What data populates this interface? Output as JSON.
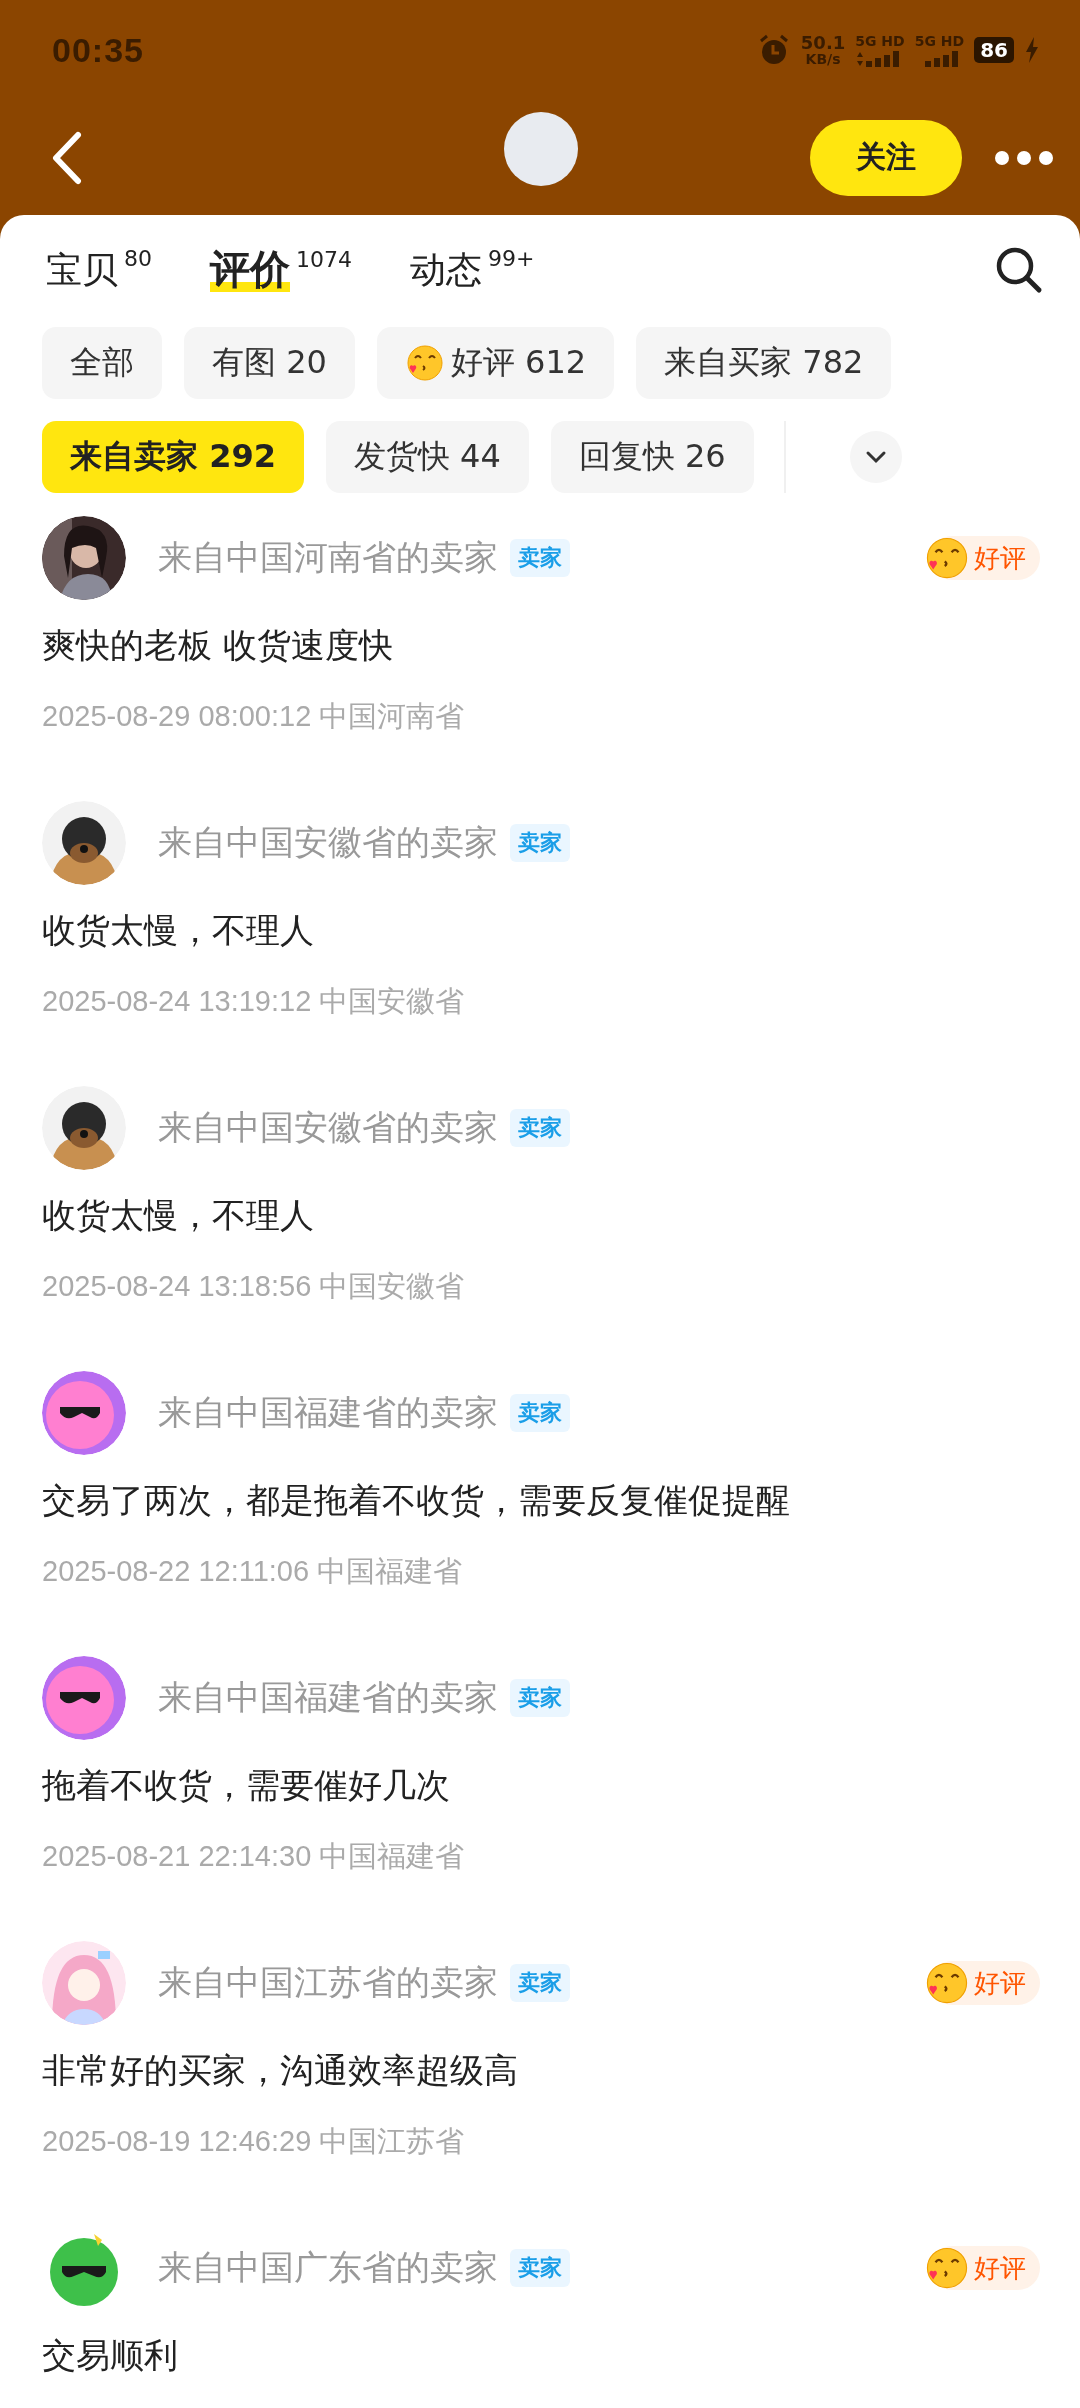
{
  "status_bar": {
    "time": "00:35",
    "speed": "50.1",
    "speed_unit": "KB/s",
    "network_1": "5G HD",
    "network_2": "5G HD",
    "battery": "86",
    "charging": true
  },
  "nav": {
    "follow_button": "关注"
  },
  "tabs": [
    {
      "label": "宝贝",
      "count": "80",
      "selected": false
    },
    {
      "label": "评价",
      "count": "1074",
      "selected": true
    },
    {
      "label": "动态",
      "count": "99+",
      "selected": false
    }
  ],
  "filter_rows": [
    [
      {
        "label": "全部",
        "selected": false
      },
      {
        "label": "有图 20",
        "selected": false
      },
      {
        "label": "好评 612",
        "selected": false,
        "kind": "emoji"
      },
      {
        "label": "来自买家 782",
        "selected": false
      }
    ],
    [
      {
        "label": "来自卖家 292",
        "selected": true
      },
      {
        "label": "发货快 44",
        "selected": false
      },
      {
        "label": "回复快 26",
        "selected": false
      }
    ]
  ],
  "reviews": [
    {
      "author": "来自中国河南省的卖家",
      "role": "卖家",
      "rating": "好评",
      "comment": "爽快的老板 收货速度快",
      "date": "2025-08-29 08:00:12 中国河南省"
    },
    {
      "author": "来自中国安徽省的卖家",
      "role": "卖家",
      "comment": "收货太慢，不理人",
      "date": "2025-08-24 13:19:12 中国安徽省"
    },
    {
      "author": "来自中国安徽省的卖家",
      "role": "卖家",
      "comment": "收货太慢，不理人",
      "date": "2025-08-24 13:18:56 中国安徽省"
    },
    {
      "author": "来自中国福建省的卖家",
      "role": "卖家",
      "comment": "交易了两次，都是拖着不收货，需要反复催促提醒",
      "date": "2025-08-22 12:11:06 中国福建省"
    },
    {
      "author": "来自中国福建省的卖家",
      "role": "卖家",
      "comment": "拖着不收货，需要催好几次",
      "date": "2025-08-21 22:14:30 中国福建省"
    },
    {
      "author": "来自中国江苏省的卖家",
      "role": "卖家",
      "rating": "好评",
      "comment": "非常好的买家，沟通效率超级高",
      "date": "2025-08-19 12:46:29 中国江苏省"
    },
    {
      "author": "来自中国广东省的卖家",
      "role": "卖家",
      "rating": "好评",
      "comment": "交易顺利"
    }
  ]
}
